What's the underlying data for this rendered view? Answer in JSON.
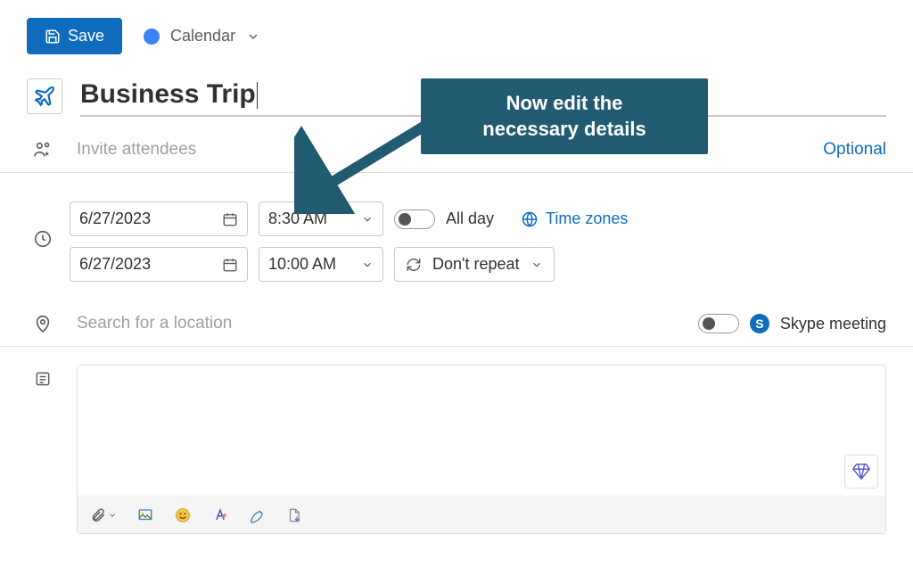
{
  "toolbar": {
    "save_label": "Save",
    "calendar_label": "Calendar"
  },
  "event": {
    "title": "Business Trip"
  },
  "attendees": {
    "placeholder": "Invite attendees",
    "optional_label": "Optional"
  },
  "time": {
    "start_date": "6/27/2023",
    "start_time": "8:30 AM",
    "end_date": "6/27/2023",
    "end_time": "10:00 AM",
    "all_day_label": "All day",
    "all_day_on": false,
    "time_zones_label": "Time zones",
    "repeat_label": "Don't repeat"
  },
  "location": {
    "placeholder": "Search for a location",
    "skype_toggle_on": false,
    "skype_label": "Skype meeting"
  },
  "callout": {
    "line1": "Now edit the",
    "line2": "necessary details"
  }
}
